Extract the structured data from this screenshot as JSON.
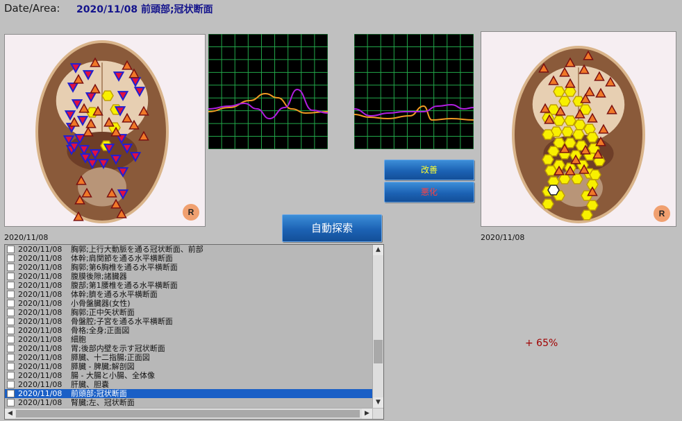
{
  "header": {
    "label": "Date/Area:",
    "value": "2020/11/08 前頭部;冠状断面"
  },
  "left_panel": {
    "badge": "R",
    "date_caption": "2020/11/08"
  },
  "right_panel": {
    "badge": "R",
    "date_caption": "2020/11/08"
  },
  "buttons": {
    "improve": "改善",
    "worsen": "悪化",
    "auto_search": "自動探索"
  },
  "result": {
    "percent": "+ 65%"
  },
  "graph_colors": {
    "grid": "#22a84a",
    "series_a": "#f09a22",
    "series_b": "#b01ee0",
    "background": "#000000"
  },
  "marker_colors": {
    "triangle_fill": "#f07828",
    "triangle_edge": "#7a1010",
    "inverted_fill": "#e01040",
    "inverted_edge": "#2020d0",
    "hexagon_fill": "#f8f000",
    "hexagon_edge": "#c0a000"
  },
  "list": {
    "selected_index": 16,
    "items": [
      {
        "date": "2020/11/08",
        "label": "胸郭;上行大動脈を通る冠状断面、前部"
      },
      {
        "date": "2020/11/08",
        "label": "体幹;肩関節を通る水平横断面"
      },
      {
        "date": "2020/11/08",
        "label": "胸郭;第6胸椎を通る水平横断面"
      },
      {
        "date": "2020/11/08",
        "label": "腹膜後隙;諸臓器"
      },
      {
        "date": "2020/11/08",
        "label": "腹部;第1腰椎を通る水平横断面"
      },
      {
        "date": "2020/11/08",
        "label": "体幹;臍を通る水平横断面"
      },
      {
        "date": "2020/11/08",
        "label": "小骨盤臓器(女性)"
      },
      {
        "date": "2020/11/08",
        "label": "胸郭;正中矢状断面"
      },
      {
        "date": "2020/11/08",
        "label": "骨盤腔;子宮を通る水平横断面"
      },
      {
        "date": "2020/11/08",
        "label": "骨格;全身;正面図"
      },
      {
        "date": "2020/11/08",
        "label": "細胞"
      },
      {
        "date": "2020/11/08",
        "label": "胃;後部内壁を示す冠状断面"
      },
      {
        "date": "2020/11/08",
        "label": "膵臓、十二指腸;正面図"
      },
      {
        "date": "2020/11/08",
        "label": "膵臓 - 脾臓;解剖図"
      },
      {
        "date": "2020/11/08",
        "label": "腸 - 大腸と小腸、全体像"
      },
      {
        "date": "2020/11/08",
        "label": "肝臓、胆嚢"
      },
      {
        "date": "2020/11/08",
        "label": "前頭部;冠状断面"
      },
      {
        "date": "2020/11/08",
        "label": "腎臓;左、冠状断面"
      }
    ]
  }
}
